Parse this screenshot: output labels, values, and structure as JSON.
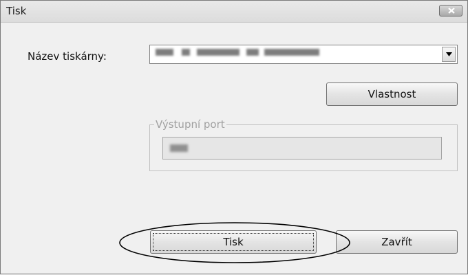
{
  "window": {
    "title": "Tisk",
    "close_icon": "close-x-icon"
  },
  "form": {
    "printer_label": "Název tiskárny:",
    "printer_value": "████ ██ ██████ █ ██████",
    "properties_button": "Vlastnost",
    "output_port_label": "Výstupní port",
    "output_port_value": "███"
  },
  "buttons": {
    "print": "Tisk",
    "close": "Zavřít"
  },
  "annotation": {
    "color": "#000000",
    "shape": "ellipse"
  }
}
